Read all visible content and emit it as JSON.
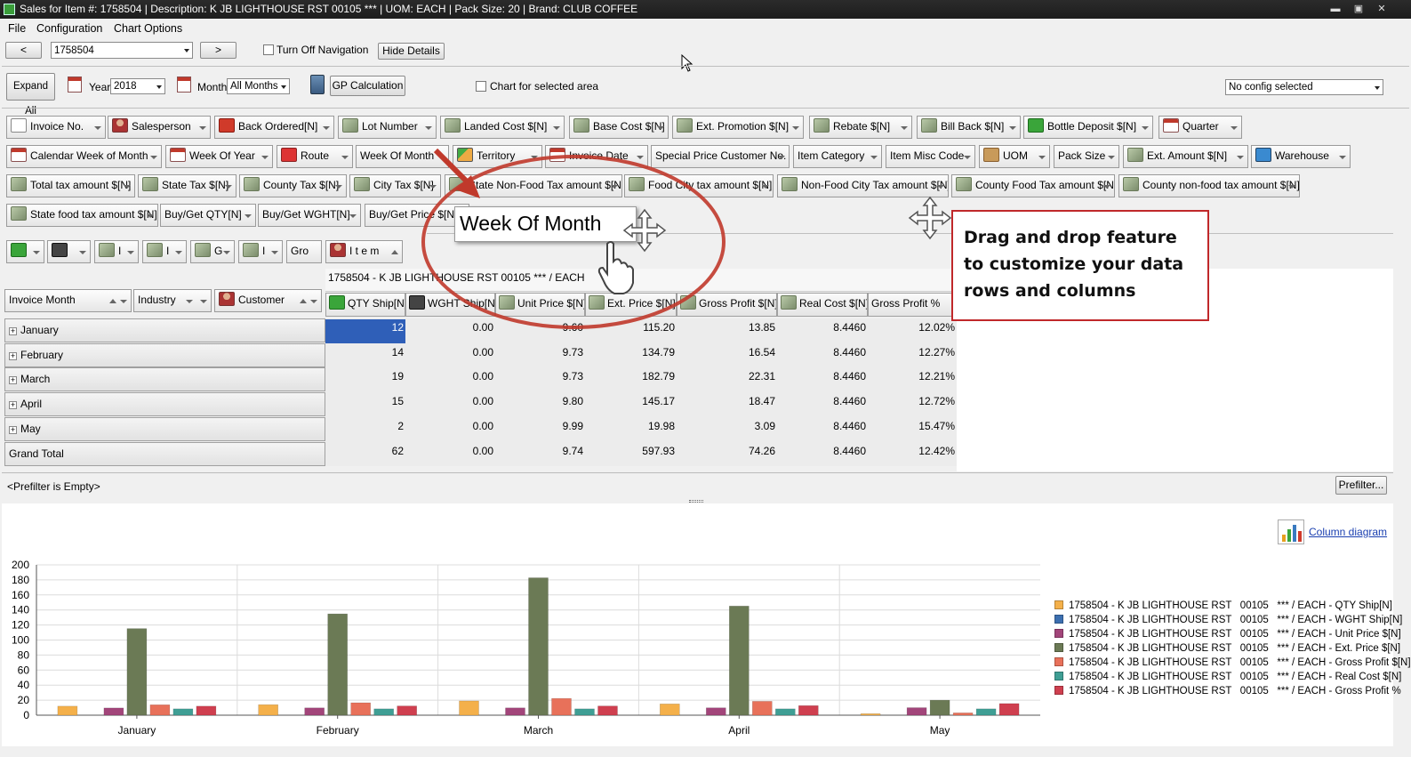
{
  "window": {
    "title": "Sales for Item #: 1758504 | Description: K JB LIGHTHOUSE RST   00105   *** | UOM: EACH | Pack Size: 20 | Brand: CLUB COFFEE",
    "min": "▬",
    "max": "▣",
    "close": "✕"
  },
  "menu": {
    "file": "File",
    "configuration": "Configuration",
    "chart_options": "Chart Options"
  },
  "nav": {
    "prev": "<",
    "next": ">",
    "item_value": "1758504",
    "turn_off_nav": "Turn Off Navigation",
    "hide_details": "Hide Details"
  },
  "toolbar": {
    "expand_all": "Expand All",
    "year_label": "Year",
    "year_value": "2018",
    "month_label": "Month",
    "month_value": "All Months",
    "gp_calc": "GP Calculation",
    "chart_selected": "Chart for selected area",
    "config_value": "No config selected"
  },
  "fields_row1": [
    "Invoice No.",
    "Salesperson",
    "Back Ordered[N]",
    "Lot Number",
    "Landed Cost $[N]",
    "Base Cost $[N]",
    "Ext. Promotion $[N]",
    "Rebate $[N]",
    "Bill Back $[N]",
    "Bottle Deposit $[N]",
    "Quarter"
  ],
  "fields_row2": [
    "Calendar Week of Month",
    "Week Of Year",
    "Route",
    "Week Of Month",
    "Territory",
    "Invoice Date",
    "Special Price Customer No.",
    "Item Category",
    "Item Misc Code",
    "UOM",
    "Pack Size",
    "Ext. Amount $[N]",
    "Warehouse"
  ],
  "fields_row3": [
    "Total tax amount $[N]",
    "State Tax $[N]",
    "County Tax $[N]",
    "City Tax $[N]",
    "State Non-Food Tax amount $[N]",
    "Food City tax amount $[N]",
    "Non-Food City Tax amount $[N]",
    "County Food Tax amount $[N]",
    "County non-food tax amount $[N]"
  ],
  "fields_row4": [
    "State food tax amount $[N]",
    "Buy/Get QTY[N]",
    "Buy/Get WGHT[N]",
    "Buy/Get Price $[N]"
  ],
  "filter_small": [
    "",
    "",
    "I",
    "I",
    "G",
    "I",
    "Gro"
  ],
  "item_field": "I t e m",
  "column_header_title": "1758504 - K JB LIGHTHOUSE RST   00105   *** / EACH",
  "row_fields": [
    "Invoice Month",
    "Industry",
    "Customer"
  ],
  "columns": [
    "QTY Ship[N]",
    "WGHT Ship[N]",
    "Unit Price $[N]",
    "Ext. Price $[N]",
    "Gross Profit $[N]",
    "Real Cost $[N]",
    "Gross Profit %"
  ],
  "rows": [
    {
      "label": "January",
      "values": [
        "12",
        "0.00",
        "9.60",
        "115.20",
        "13.85",
        "8.4460",
        "12.02%"
      ]
    },
    {
      "label": "February",
      "values": [
        "14",
        "0.00",
        "9.73",
        "134.79",
        "16.54",
        "8.4460",
        "12.27%"
      ]
    },
    {
      "label": "March",
      "values": [
        "19",
        "0.00",
        "9.73",
        "182.79",
        "22.31",
        "8.4460",
        "12.21%"
      ]
    },
    {
      "label": "April",
      "values": [
        "15",
        "0.00",
        "9.80",
        "145.17",
        "18.47",
        "8.4460",
        "12.72%"
      ]
    },
    {
      "label": "May",
      "values": [
        "2",
        "0.00",
        "9.99",
        "19.98",
        "3.09",
        "8.4460",
        "15.47%"
      ]
    }
  ],
  "grand_total": {
    "label": "Grand Total",
    "values": [
      "62",
      "0.00",
      "9.74",
      "597.93",
      "74.26",
      "8.4460",
      "12.42%"
    ]
  },
  "prefilter": {
    "text": "<Prefilter is Empty>",
    "button": "Prefilter..."
  },
  "column_diagram": "Column diagram",
  "drag_ghost": "Week Of Month",
  "callout": "Drag and drop feature to customize your data rows and columns",
  "chart_data": {
    "type": "bar",
    "categories": [
      "January",
      "February",
      "March",
      "April",
      "May"
    ],
    "ylim": [
      0,
      200
    ],
    "yticks": [
      0,
      20,
      40,
      60,
      80,
      100,
      120,
      140,
      160,
      180,
      200
    ],
    "grid": true,
    "legend": "right",
    "series": [
      {
        "name": "1758504 - K JB LIGHTHOUSE RST   00105   *** / EACH - QTY Ship[N]",
        "color": "#f4b04a",
        "values": [
          12,
          14,
          19,
          15,
          2
        ]
      },
      {
        "name": "1758504 - K JB LIGHTHOUSE RST   00105   *** / EACH - WGHT Ship[N]",
        "color": "#3c6fb0",
        "values": [
          0,
          0,
          0,
          0,
          0
        ]
      },
      {
        "name": "1758504 - K JB LIGHTHOUSE RST   00105   *** / EACH - Unit Price $[N]",
        "color": "#a2457a",
        "values": [
          9.6,
          9.73,
          9.73,
          9.8,
          9.99
        ]
      },
      {
        "name": "1758504 - K JB LIGHTHOUSE RST   00105   *** / EACH - Ext. Price $[N]",
        "color": "#6b7a55",
        "values": [
          115.2,
          134.79,
          182.79,
          145.17,
          19.98
        ]
      },
      {
        "name": "1758504 - K JB LIGHTHOUSE RST   00105   *** / EACH - Gross Profit $[N]",
        "color": "#e8715a",
        "values": [
          13.85,
          16.54,
          22.31,
          18.47,
          3.09
        ]
      },
      {
        "name": "1758504 - K JB LIGHTHOUSE RST   00105   *** / EACH - Real Cost $[N]",
        "color": "#3f9e94",
        "values": [
          8.446,
          8.446,
          8.446,
          8.446,
          8.446
        ]
      },
      {
        "name": "1758504 - K JB LIGHTHOUSE RST   00105   *** / EACH - Gross Profit %",
        "color": "#cf3f4f",
        "values": [
          12.02,
          12.27,
          12.21,
          12.72,
          15.47
        ]
      }
    ]
  }
}
